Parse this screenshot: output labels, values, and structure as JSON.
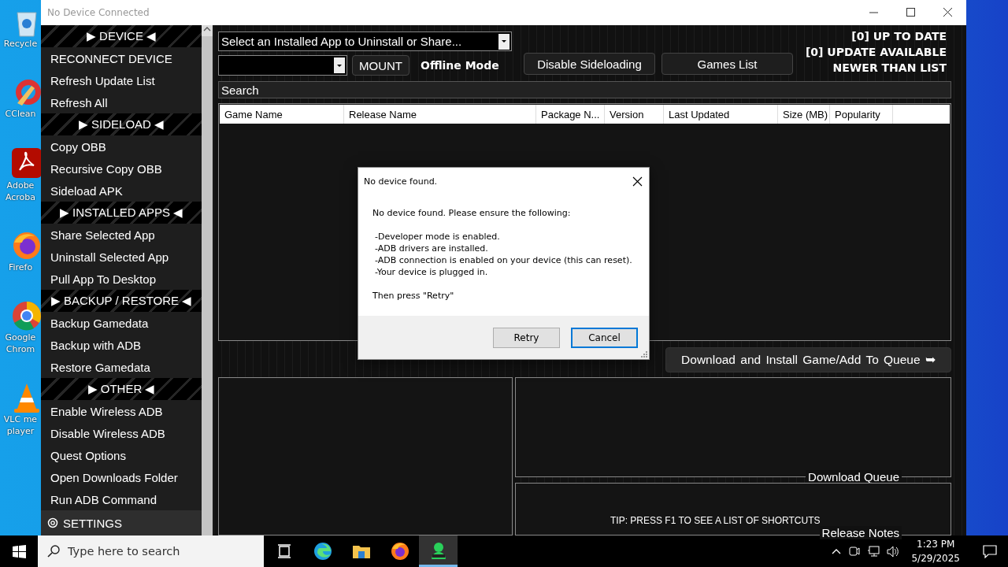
{
  "desktop_icons": [
    {
      "kind": "recycle",
      "label": "Recycle"
    },
    {
      "kind": "cleaner",
      "label": "CClean"
    },
    {
      "kind": "pdf",
      "label": "Adobe Acroba"
    },
    {
      "kind": "fox",
      "label": "Firefo"
    },
    {
      "kind": "globe",
      "label": "Google Chrom"
    },
    {
      "kind": "cone",
      "label": "VLC me player"
    }
  ],
  "window": {
    "title": "No Device Connected"
  },
  "sidebar": {
    "sections": [
      {
        "title": "▶ DEVICE ◀",
        "items": [
          "RECONNECT DEVICE",
          "Refresh Update List",
          "Refresh All"
        ]
      },
      {
        "title": "▶ SIDELOAD ◀",
        "items": [
          "Copy OBB",
          "Recursive Copy OBB",
          "Sideload APK"
        ]
      },
      {
        "title": "▶ INSTALLED APPS ◀",
        "items": [
          "Share Selected App",
          "Uninstall Selected App",
          "Pull App To Desktop"
        ]
      },
      {
        "title": "▶ BACKUP / RESTORE ◀",
        "items": [
          "Backup Gamedata",
          "Backup with ADB",
          "Restore Gamedata"
        ]
      },
      {
        "title": "▶ OTHER ◀",
        "items": [
          "Enable Wireless ADB",
          "Disable Wireless ADB",
          "Quest Options",
          "Open Downloads Folder",
          "Run ADB Command"
        ]
      }
    ],
    "settings": "SETTINGS"
  },
  "toolbar": {
    "app_select": "Select an Installed App to Uninstall or Share...",
    "mount_button": "MOUNT",
    "mode_label": "Offline Mode",
    "buttons": [
      "Disable Sideloading",
      "Games List"
    ]
  },
  "status": [
    "[0] UP TO DATE",
    "[0] UPDATE AVAILABLE",
    "NEWER THAN LIST"
  ],
  "search": {
    "placeholder": "Search"
  },
  "table": {
    "columns": [
      "Game Name",
      "Release Name",
      "Package N...",
      "Version",
      "Last Updated",
      "Size (MB)",
      "Popularity"
    ]
  },
  "download_button": "Download and Install Game/Add To Queue ➥",
  "panels": {
    "queue_label": "Download Queue",
    "tip": "TIP: PRESS F1 TO SEE A LIST OF SHORTCUTS",
    "notes_label": "Release Notes"
  },
  "dialog": {
    "title": "No device found.",
    "intro": "No device found. Please ensure the following:",
    "lines": [
      "-Developer mode is enabled.",
      "-ADB drivers are installed.",
      "-ADB connection is enabled on your device (this can reset).",
      "-Your device is plugged in."
    ],
    "outro": "Then press \"Retry\"",
    "buttons": [
      {
        "label": "Retry",
        "selected": false
      },
      {
        "label": "Cancel",
        "selected": true
      }
    ]
  },
  "taskbar": {
    "search_placeholder": "Type here to search",
    "apps": [
      {
        "kind": "taskview",
        "selected": false
      },
      {
        "kind": "edge",
        "selected": false
      },
      {
        "kind": "folder",
        "selected": false
      },
      {
        "kind": "fox",
        "selected": false
      },
      {
        "kind": "figure",
        "selected": true
      }
    ],
    "time": "1:23 PM",
    "date": "5/29/2025"
  }
}
